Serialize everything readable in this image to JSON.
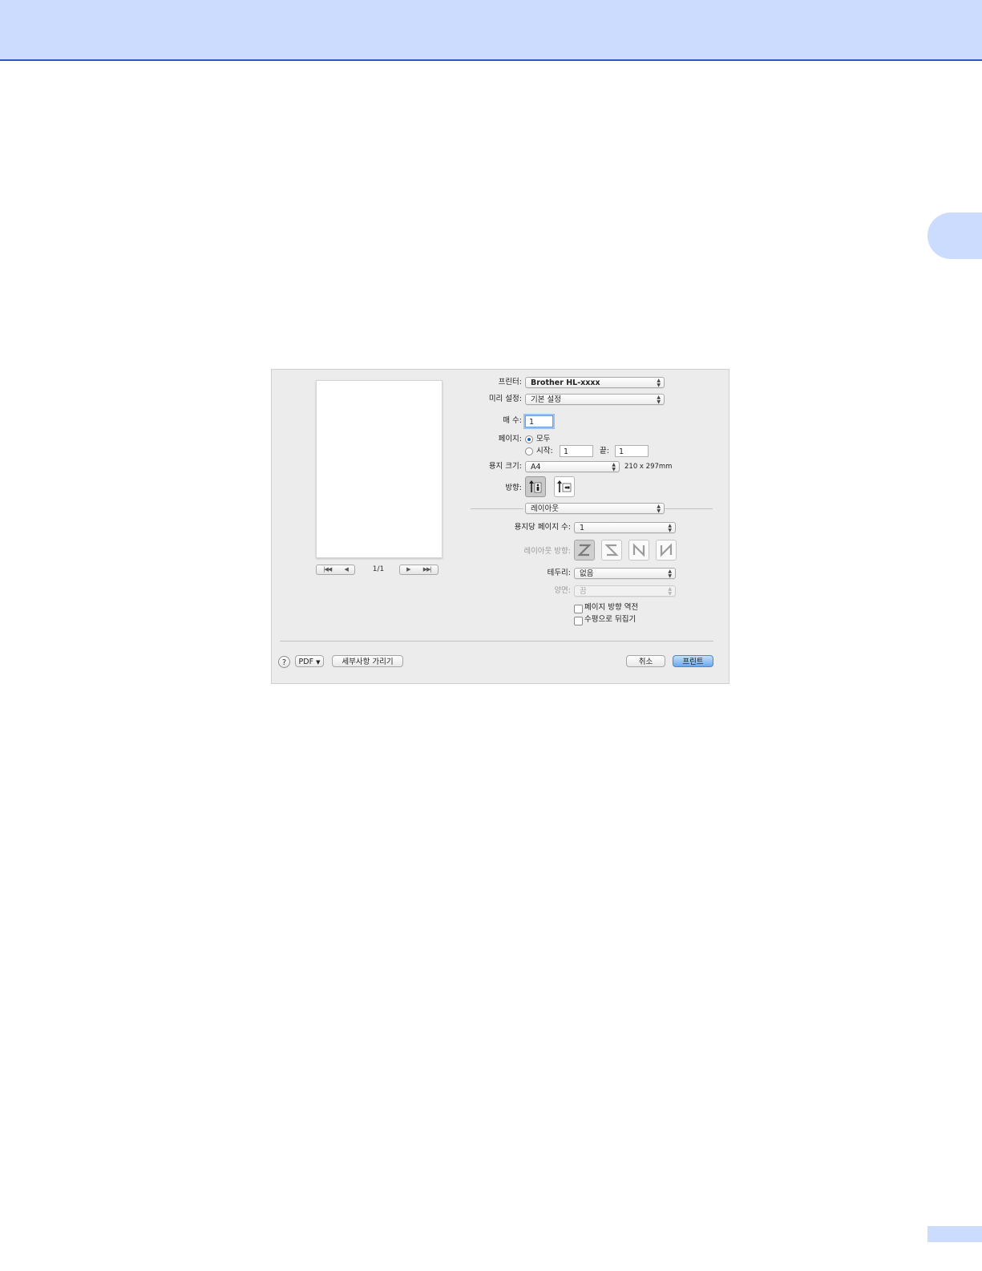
{
  "page": {
    "chapter_number": "",
    "page_number": ""
  },
  "preview": {
    "page_counter": "1/1"
  },
  "form": {
    "printer": {
      "label": "프린터:",
      "value": "Brother HL-xxxx"
    },
    "presets": {
      "label": "미리 설정:",
      "value": "기본 설정"
    },
    "copies": {
      "label": "매 수:",
      "value": "1"
    },
    "pages": {
      "label": "페이지:",
      "all_label": "모두",
      "from_label": "시작:",
      "from_value": "1",
      "to_label": "끝:",
      "to_value": "1",
      "selected": "all"
    },
    "paper_size": {
      "label": "용지 크기:",
      "value": "A4",
      "dimensions": "210 x 297mm"
    },
    "orientation": {
      "label": "방향:",
      "selected": "portrait"
    },
    "panel": {
      "value": "레이아웃"
    },
    "pages_per_sheet": {
      "label": "용지당 페이지 수:",
      "value": "1"
    },
    "layout_direction": {
      "label": "레이아웃 방향:",
      "options": [
        "z-icon",
        "reverse-z-icon",
        "n-icon",
        "reverse-n-icon"
      ],
      "selected": 0
    },
    "border": {
      "label": "테두리:",
      "value": "없음"
    },
    "two_sided": {
      "label": "양면:",
      "value": "끔"
    },
    "reverse_orientation": {
      "label": "페이지 방향 역전",
      "checked": false
    },
    "flip_horizontally": {
      "label": "수평으로 뒤집기",
      "checked": false
    }
  },
  "footer": {
    "help": "?",
    "pdf": "PDF",
    "hide_details": "세부사항 가리기",
    "cancel": "취소",
    "print": "프린트"
  },
  "colors": {
    "header": "#ccdcff",
    "header_rule": "#2e55c8",
    "dialog_bg": "#ececec",
    "default_button": "#6aa9ee"
  }
}
